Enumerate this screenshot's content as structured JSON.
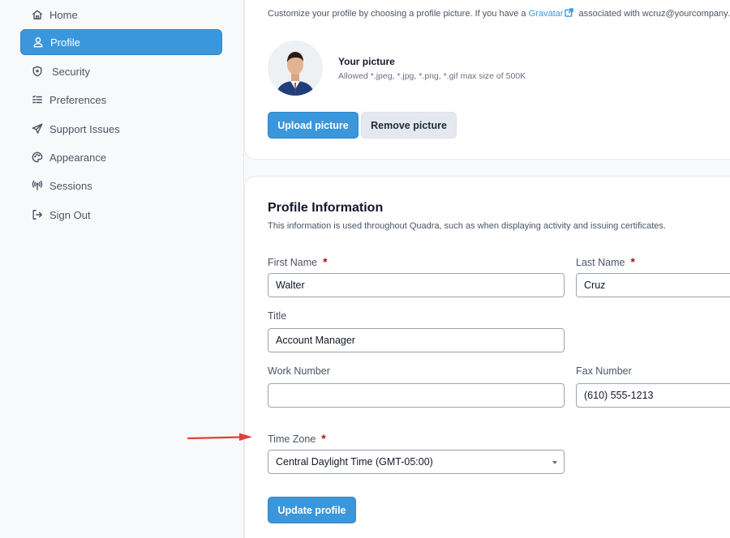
{
  "sidebar": {
    "items": [
      {
        "label": "Home",
        "icon": "home-icon",
        "active": false
      },
      {
        "label": "Profile",
        "icon": "user-icon",
        "active": true
      },
      {
        "label": "Security",
        "icon": "shield-icon",
        "active": false
      },
      {
        "label": "Preferences",
        "icon": "list-check-icon",
        "active": false
      },
      {
        "label": "Support Issues",
        "icon": "send-icon",
        "active": false
      },
      {
        "label": "Appearance",
        "icon": "palette-icon",
        "active": false
      },
      {
        "label": "Sessions",
        "icon": "broadcast-icon",
        "active": false
      },
      {
        "label": "Sign Out",
        "icon": "sign-out-icon",
        "active": false
      }
    ]
  },
  "picture": {
    "intro_prefix": "Customize your profile by choosing a profile picture. If you have a",
    "gravatar_link": "Gravatar",
    "intro_suffix": "associated with wcruz@yourcompany.c",
    "title": "Your picture",
    "allowed": "Allowed *.jpeg, *.jpg, *.png, *.gif max size of 500K",
    "upload_label": "Upload picture",
    "remove_label": "Remove picture"
  },
  "profile": {
    "title": "Profile Information",
    "subtitle": "This information is used throughout Quadra, such as when displaying activity and issuing certificates.",
    "first_name_label": "First Name",
    "first_name_value": "Walter",
    "last_name_label": "Last Name",
    "last_name_value": "Cruz",
    "title_label": "Title",
    "title_value": "Account Manager",
    "work_number_label": "Work Number",
    "work_number_value": "",
    "fax_number_label": "Fax Number",
    "fax_number_value": "(610) 555-1213",
    "time_zone_label": "Time Zone",
    "time_zone_value": "Central Daylight Time (GMT-05:00)",
    "required_mark": "*",
    "update_label": "Update profile"
  },
  "colors": {
    "accent": "#3b97dc",
    "required": "#a01818",
    "annotation_arrow": "#e0403a"
  }
}
